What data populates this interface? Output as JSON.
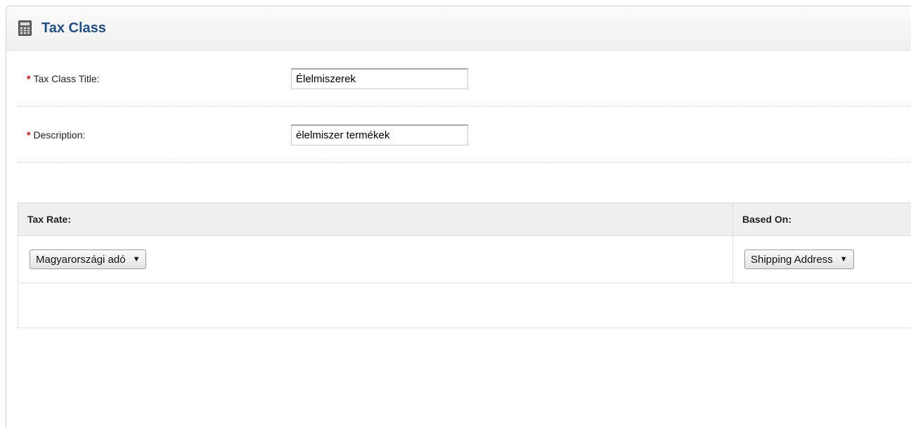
{
  "header": {
    "title": "Tax Class",
    "icon": "calculator-icon"
  },
  "form": {
    "title_label": "Tax Class Title:",
    "title_value": "Élelmiszerek",
    "description_label": "Description:",
    "description_value": "élelmiszer termékek",
    "required_mark": "*"
  },
  "rates": {
    "col_tax_rate": "Tax Rate:",
    "col_based_on": "Based On:",
    "rows": [
      {
        "tax_rate": "Magyarországi adó",
        "based_on": "Shipping Address"
      }
    ]
  },
  "colors": {
    "title": "#1f4e8c",
    "required": "#ee0000"
  }
}
